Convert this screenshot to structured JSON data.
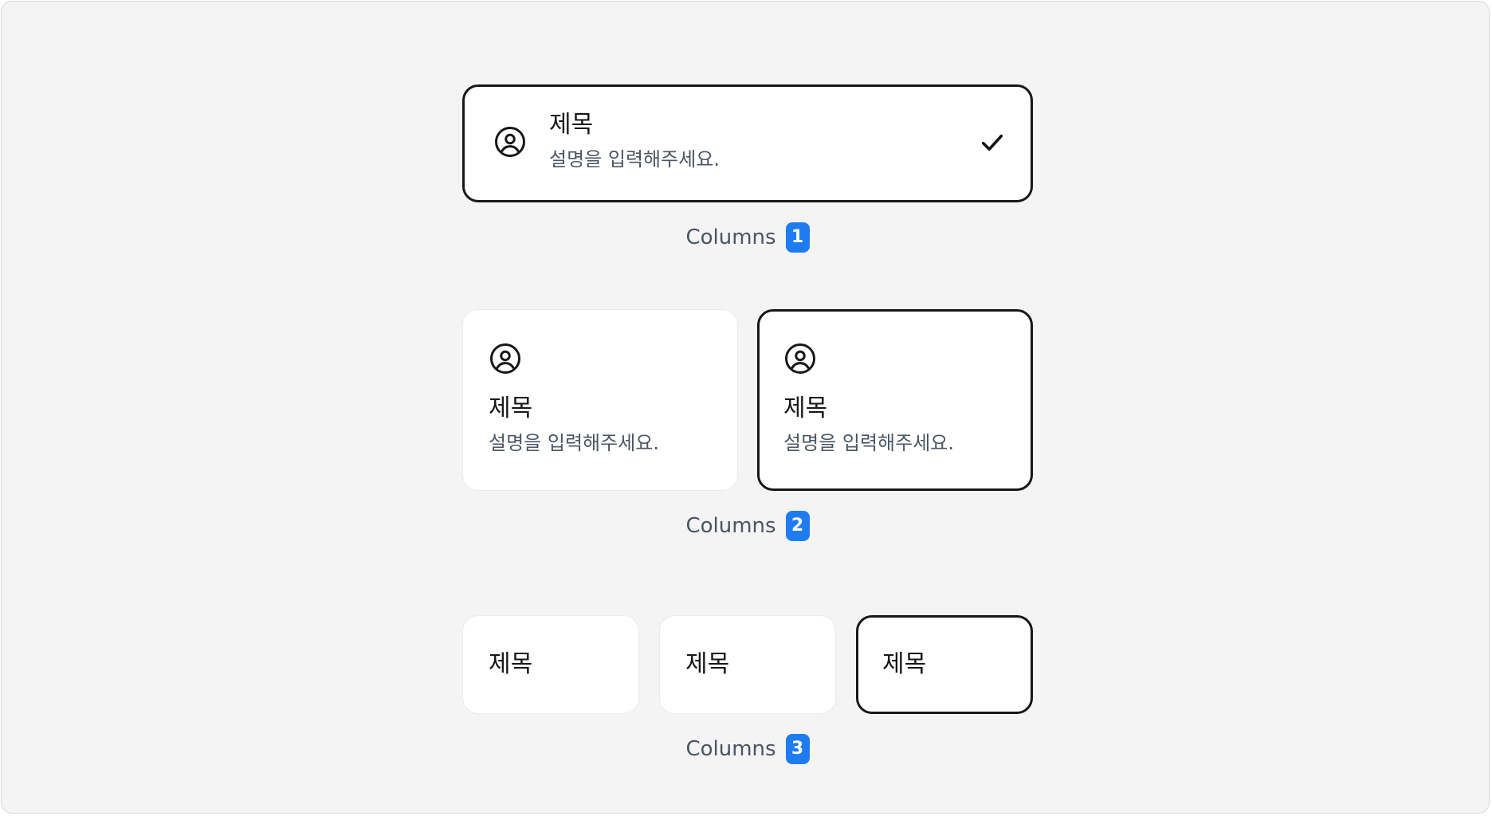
{
  "sections": [
    {
      "caption": "Columns",
      "count": "1",
      "cards": [
        {
          "title": "제목",
          "description": "설명을 입력해주세요.",
          "icon": "user-circle-icon",
          "selected": true,
          "check": "checkmark-icon"
        }
      ]
    },
    {
      "caption": "Columns",
      "count": "2",
      "cards": [
        {
          "title": "제목",
          "description": "설명을 입력해주세요.",
          "icon": "user-circle-icon",
          "selected": false
        },
        {
          "title": "제목",
          "description": "설명을 입력해주세요.",
          "icon": "user-circle-icon",
          "selected": true
        }
      ]
    },
    {
      "caption": "Columns",
      "count": "3",
      "cards": [
        {
          "title": "제목",
          "selected": false
        },
        {
          "title": "제목",
          "selected": false
        },
        {
          "title": "제목",
          "selected": true
        }
      ]
    }
  ],
  "colors": {
    "background": "#f4f4f4",
    "card": "#ffffff",
    "selected_border": "#171717",
    "badge": "#1f7cf0",
    "description_text": "#4b5563"
  }
}
